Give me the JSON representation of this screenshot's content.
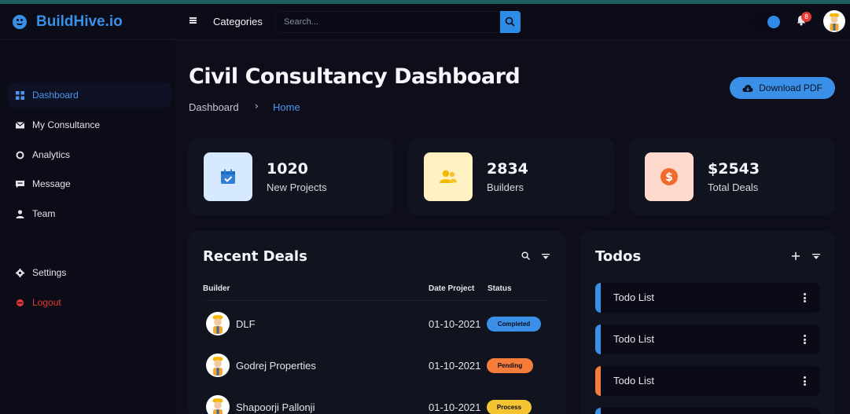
{
  "brand": {
    "name": "BuildHive.io"
  },
  "topbar": {
    "categories_label": "Categories",
    "search_placeholder": "Search...",
    "notification_count": "8"
  },
  "sidebar": {
    "items": [
      {
        "label": "Dashboard",
        "icon": "grid-icon"
      },
      {
        "label": "My Consultance",
        "icon": "mail-icon"
      },
      {
        "label": "Analytics",
        "icon": "circle-icon"
      },
      {
        "label": "Message",
        "icon": "chat-icon"
      },
      {
        "label": "Team",
        "icon": "user-icon"
      },
      {
        "label": "Settings",
        "icon": "gear-icon"
      },
      {
        "label": "Logout",
        "icon": "logout-icon"
      }
    ]
  },
  "header": {
    "title": "Civil Consultancy Dashboard",
    "breadcrumb": [
      "Dashboard",
      "Home"
    ],
    "download_label": "Download PDF"
  },
  "stats": [
    {
      "value": "1020",
      "label": "New Projects",
      "color": "#d7e9ff"
    },
    {
      "value": "2834",
      "label": "Builders",
      "color": "#fff1c2"
    },
    {
      "value": "$2543",
      "label": "Total Deals",
      "color": "#ffd9cc"
    }
  ],
  "deals": {
    "title": "Recent Deals",
    "columns": [
      "Builder",
      "Date Project",
      "Status"
    ],
    "rows": [
      {
        "builder": "DLF",
        "date": "01-10-2021",
        "status": "Completed",
        "status_color": "#3a8fe6"
      },
      {
        "builder": "Godrej Properties",
        "date": "01-10-2021",
        "status": "Pending",
        "status_color": "#f57c3b"
      },
      {
        "builder": "Shapoorji Pallonji",
        "date": "01-10-2021",
        "status": "Process",
        "status_color": "#f5c531"
      }
    ]
  },
  "todos": {
    "title": "Todos",
    "items": [
      {
        "text": "Todo List",
        "color": "#3a8fe6"
      },
      {
        "text": "Todo List",
        "color": "#3a8fe6"
      },
      {
        "text": "Todo List",
        "color": "#f57c3b"
      }
    ]
  }
}
